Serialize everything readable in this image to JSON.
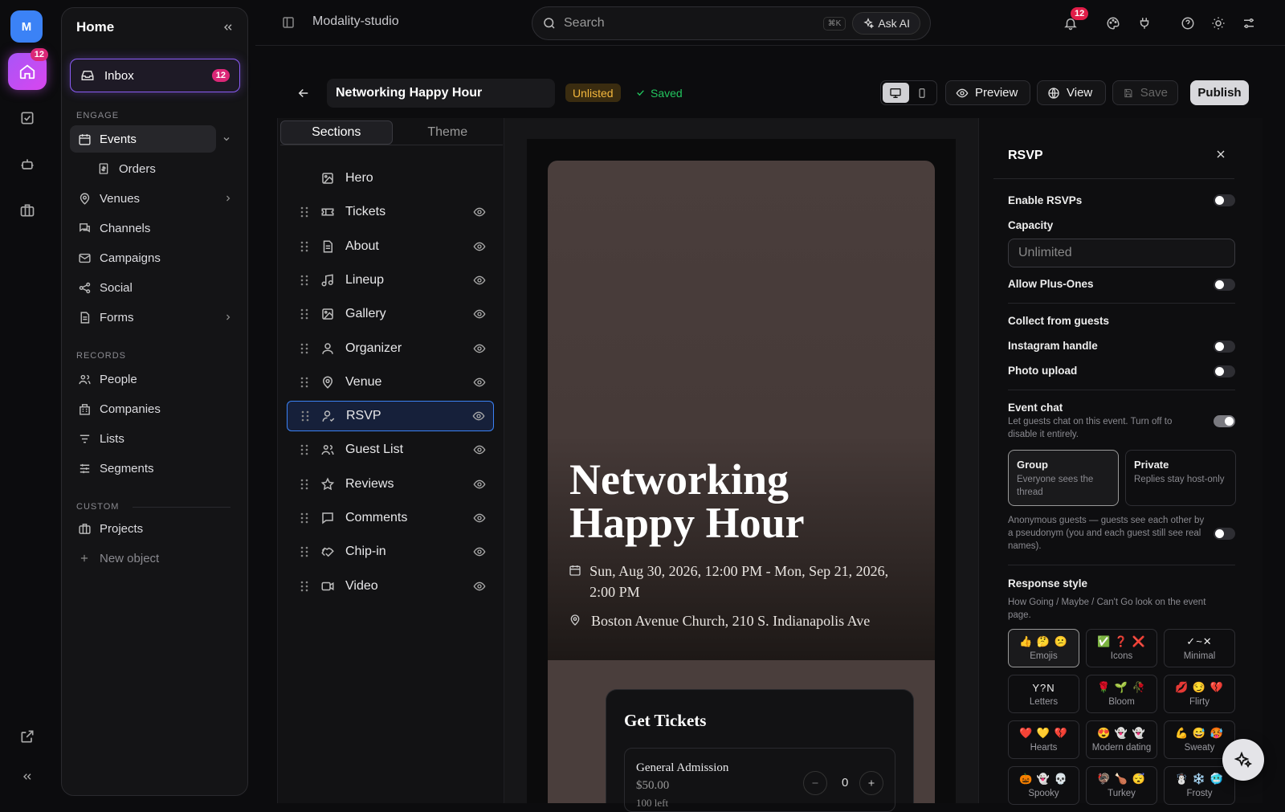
{
  "rail": {
    "avatar_letter": "M",
    "home_badge": "12"
  },
  "sidebar": {
    "title": "Home",
    "inbox": {
      "label": "Inbox",
      "badge": "12"
    },
    "engage_label": "ENGAGE",
    "records_label": "RECORDS",
    "custom_label": "CUSTOM",
    "engage": [
      {
        "label": "Events",
        "icon": "calendar-icon"
      },
      {
        "label": "Orders",
        "icon": "receipt-icon"
      },
      {
        "label": "Venues",
        "icon": "pin-icon"
      },
      {
        "label": "Channels",
        "icon": "chat-icon"
      },
      {
        "label": "Campaigns",
        "icon": "mail-icon"
      },
      {
        "label": "Social",
        "icon": "share-icon"
      },
      {
        "label": "Forms",
        "icon": "document-icon"
      }
    ],
    "records": [
      {
        "label": "People",
        "icon": "people-icon"
      },
      {
        "label": "Companies",
        "icon": "building-icon"
      },
      {
        "label": "Lists",
        "icon": "list-icon"
      },
      {
        "label": "Segments",
        "icon": "sliders-icon"
      }
    ],
    "custom": [
      {
        "label": "Projects",
        "icon": "briefcase-icon"
      },
      {
        "label": "New object",
        "icon": "plus-icon"
      }
    ]
  },
  "topbar": {
    "workspace": "Modality-studio",
    "search_placeholder": "Search",
    "shortcut": "⌘K",
    "ask_ai": "Ask AI",
    "notification_badge": "12"
  },
  "editor": {
    "title": "Networking Happy Hour",
    "status": "Unlisted",
    "saved": "Saved",
    "preview": "Preview",
    "view": "View",
    "save": "Save",
    "publish": "Publish"
  },
  "sections_panel": {
    "tabs": [
      "Sections",
      "Theme"
    ],
    "items": [
      {
        "label": "Hero",
        "icon": "image-icon"
      },
      {
        "label": "Tickets",
        "icon": "ticket-icon"
      },
      {
        "label": "About",
        "icon": "document-icon"
      },
      {
        "label": "Lineup",
        "icon": "music-icon"
      },
      {
        "label": "Gallery",
        "icon": "image-icon"
      },
      {
        "label": "Organizer",
        "icon": "user-icon"
      },
      {
        "label": "Venue",
        "icon": "pin-icon"
      },
      {
        "label": "RSVP",
        "icon": "user-check-icon"
      },
      {
        "label": "Guest List",
        "icon": "people-icon"
      },
      {
        "label": "Reviews",
        "icon": "star-icon"
      },
      {
        "label": "Comments",
        "icon": "comment-icon"
      },
      {
        "label": "Chip-in",
        "icon": "handshake-icon"
      },
      {
        "label": "Video",
        "icon": "video-icon"
      }
    ],
    "selected": "RSVP"
  },
  "preview": {
    "event_title": "Networking Happy Hour",
    "datetime": "Sun, Aug 30, 2026, 12:00 PM - Mon, Sep 21, 2026, 2:00 PM",
    "location": "Boston Avenue Church, 210 S. Indianapolis Ave",
    "tickets_heading": "Get Tickets",
    "ticket_name": "General Admission",
    "ticket_price": "$50.00",
    "ticket_left": "100 left",
    "ticket_qty": "0",
    "hero_color": "#4a3e3c"
  },
  "rsvp_panel": {
    "title": "RSVP",
    "enable_rsvps": "Enable RSVPs",
    "capacity": "Capacity",
    "capacity_placeholder": "Unlimited",
    "allow_plus_ones": "Allow Plus-Ones",
    "collect_heading": "Collect from guests",
    "instagram": "Instagram handle",
    "photo_upload": "Photo upload",
    "event_chat": "Event chat",
    "event_chat_desc": "Let guests chat on this event. Turn off to disable it entirely.",
    "chat_options": [
      {
        "title": "Group",
        "desc": "Everyone sees the thread"
      },
      {
        "title": "Private",
        "desc": "Replies stay host-only"
      }
    ],
    "anonymous_desc": "Anonymous guests — guests see each other by a pseudonym (you and each guest still see real names).",
    "response_style": "Response style",
    "response_desc": "How Going / Maybe / Can't Go look on the event page.",
    "toggles": {
      "enable_rsvps": false,
      "allow_plus_ones": false,
      "instagram": false,
      "photo_upload": false,
      "event_chat": true,
      "anonymous": false
    },
    "styles": [
      {
        "glyphs": "👍 🤔 😕",
        "name": "Emojis"
      },
      {
        "glyphs": "✅ ❓ ❌",
        "name": "Icons"
      },
      {
        "glyphs": "✓~✕",
        "name": "Minimal"
      },
      {
        "glyphs": "Y?N",
        "name": "Letters"
      },
      {
        "glyphs": "🌹 🌱 🥀",
        "name": "Bloom"
      },
      {
        "glyphs": "💋 😏 💔",
        "name": "Flirty"
      },
      {
        "glyphs": "❤️ 💛 💔",
        "name": "Hearts"
      },
      {
        "glyphs": "😍 👻 👻",
        "name": "Modern dating"
      },
      {
        "glyphs": "💪 😅 🥵",
        "name": "Sweaty"
      },
      {
        "glyphs": "🎃 👻 💀",
        "name": "Spooky"
      },
      {
        "glyphs": "🦃 🍗 😴",
        "name": "Turkey"
      },
      {
        "glyphs": "☃️ ❄️ 🥶",
        "name": "Frosty"
      }
    ]
  }
}
